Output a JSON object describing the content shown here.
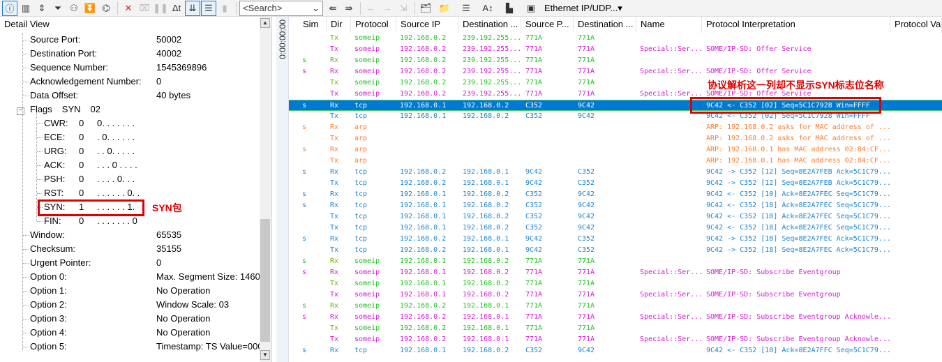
{
  "toolbar": {
    "search_placeholder": "<Search>",
    "channel": "Ethernet IP/UDP...",
    "icons": [
      "detail-view-icon",
      "statistics-icon",
      "split-icon",
      "filter-mail-icon",
      "filter-glasses-icon",
      "filter-sort-icon",
      "binoculars-icon",
      "delete-icon",
      "clear-icon",
      "pause-icon",
      "delta-time-icon",
      "scroll-down-icon",
      "filter-list-icon",
      "bar-filter-icon"
    ],
    "icons2": [
      "find-prev-icon",
      "find-next-icon",
      "back-icon",
      "forward-icon",
      "insert-icon",
      "mail-folder-icon",
      "globe-folder-icon",
      "columns-icon",
      "font-size-icon",
      "layout-icon",
      "network-icon"
    ]
  },
  "detail": {
    "title": "Detail View",
    "time": "0:00:00:00",
    "fields": [
      {
        "label": "Source Port:",
        "value": "50002"
      },
      {
        "label": "Destination Port:",
        "value": "40002"
      },
      {
        "label": "Sequence Number:",
        "value": "1545369896"
      },
      {
        "label": "Acknowledgement Number:",
        "value": "0"
      },
      {
        "label": "Data Offset:",
        "value": "40 bytes"
      }
    ],
    "flags": {
      "label": "Flags",
      "name": "SYN",
      "value": "02",
      "items": [
        {
          "label": "CWR:",
          "value": "0",
          "bits": "0. . .  . . . ."
        },
        {
          "label": "ECE:",
          "value": "0",
          "bits": ". 0. .  . . . ."
        },
        {
          "label": "URG:",
          "value": "0",
          "bits": ". . 0.  . . . ."
        },
        {
          "label": "ACK:",
          "value": "0",
          "bits": ". . . 0 . . . ."
        },
        {
          "label": "PSH:",
          "value": "0",
          "bits": ". . . .  0. . ."
        },
        {
          "label": "RST:",
          "value": "0",
          "bits": ". . . . . . 0. ."
        },
        {
          "label": "SYN:",
          "value": "1",
          "bits": ". . . . . . 1."
        },
        {
          "label": "FIN:",
          "value": "0",
          "bits": ". . . . . . . 0"
        }
      ]
    },
    "fields2": [
      {
        "label": "Window:",
        "value": "65535"
      },
      {
        "label": "Checksum:",
        "value": "35155"
      },
      {
        "label": "Urgent Pointer:",
        "value": "0"
      },
      {
        "label": "Option 0:",
        "value": "Max. Segment Size: 1460"
      },
      {
        "label": "Option 1:",
        "value": "No Operation"
      },
      {
        "label": "Option 2:",
        "value": "Window Scale: 03"
      },
      {
        "label": "Option 3:",
        "value": "No Operation"
      },
      {
        "label": "Option 4:",
        "value": "No Operation"
      },
      {
        "label": "Option 5:",
        "value": "Timestamp: TS Value=000"
      }
    ]
  },
  "annotations": {
    "syn": "SYN包",
    "interp": "协议解析这一列却不显示SYN标志位名称"
  },
  "columns": [
    "Sim",
    "Dir",
    "Protocol",
    "Source IP",
    "Destination ...",
    "Source P...",
    "Destination ...",
    "Name",
    "Protocol Interpretation",
    "Protocol Va"
  ],
  "colors": {
    "someip_green": "#1cc31c",
    "someip_magenta": "#d01ad0",
    "tcp": "#1a84d0",
    "arp": "#ff7a2a",
    "selected": "#0078d7",
    "annotation": "#e00000"
  },
  "selected_row": 6,
  "rows": [
    [
      "g",
      "",
      "Tx",
      "someip",
      "192.168.0.2",
      "239.192.255...",
      "771A",
      "771A",
      "",
      ""
    ],
    [
      "m",
      "",
      "Tx",
      "someip",
      "192.168.0.2",
      "239.192.255...",
      "771A",
      "771A",
      "Special::Ser...",
      "SOME/IP-SD: Offer Service"
    ],
    [
      "g",
      "s",
      "Rx",
      "someip",
      "192.168.0.2",
      "239.192.255...",
      "771A",
      "771A",
      "",
      ""
    ],
    [
      "m",
      "s",
      "Rx",
      "someip",
      "192.168.0.2",
      "239.192.255...",
      "771A",
      "771A",
      "Special::Ser...",
      "SOME/IP-SD: Offer Service"
    ],
    [
      "g",
      "",
      "Tx",
      "someip",
      "192.168.0.2",
      "239.192.255...",
      "771A",
      "771A",
      "",
      ""
    ],
    [
      "m",
      "",
      "Tx",
      "someip",
      "192.168.0.2",
      "239.192.255...",
      "771A",
      "771A",
      "Special::Ser...",
      "SOME/IP-SD: Offer Service"
    ],
    [
      "b",
      "s",
      "Rx",
      "tcp",
      "192.168.0.1",
      "192.168.0.2",
      "C352",
      "9C42",
      "",
      "9C42 <- C352 [02] Seq=5C1C7928 Win=FFFF"
    ],
    [
      "b",
      "",
      "Tx",
      "tcp",
      "192.168.0.1",
      "192.168.0.2",
      "C352",
      "9C42",
      "",
      "9C42 <- C352 [02] Seq=5C1C7928 Win=FFFF"
    ],
    [
      "o",
      "s",
      "Rx",
      "arp",
      "",
      "",
      "",
      "",
      "",
      "ARP: 192.168.0.2 asks for MAC address of ..."
    ],
    [
      "o",
      "",
      "Tx",
      "arp",
      "",
      "",
      "",
      "",
      "",
      "ARP: 192.168.0.2 asks for MAC address of ..."
    ],
    [
      "o",
      "s",
      "Rx",
      "arp",
      "",
      "",
      "",
      "",
      "",
      "ARP: 192.168.0.1 has MAC address 02:84:CF..."
    ],
    [
      "o",
      "",
      "Tx",
      "arp",
      "",
      "",
      "",
      "",
      "",
      "ARP: 192.168.0.1 has MAC address 02:84:CF..."
    ],
    [
      "b",
      "s",
      "Rx",
      "tcp",
      "192.168.0.2",
      "192.168.0.1",
      "9C42",
      "C352",
      "",
      "9C42 -> C352 [12] Seq=8E2A7FEB Ack=5C1C79..."
    ],
    [
      "b",
      "",
      "Tx",
      "tcp",
      "192.168.0.2",
      "192.168.0.1",
      "9C42",
      "C352",
      "",
      "9C42 -> C352 [12] Seq=8E2A7FEB Ack=5C1C79..."
    ],
    [
      "b",
      "s",
      "Rx",
      "tcp",
      "192.168.0.1",
      "192.168.0.2",
      "C352",
      "9C42",
      "",
      "9C42 <- C352 [10] Ack=8E2A7FEC Seq=5C1C79..."
    ],
    [
      "b",
      "s",
      "Rx",
      "tcp",
      "192.168.0.1",
      "192.168.0.2",
      "C352",
      "9C42",
      "",
      "9C42 <- C352 [18] Ack=8E2A7FEC Seq=5C1C79..."
    ],
    [
      "b",
      "",
      "Tx",
      "tcp",
      "192.168.0.1",
      "192.168.0.2",
      "C352",
      "9C42",
      "",
      "9C42 <- C352 [10] Ack=8E2A7FEC Seq=5C1C79..."
    ],
    [
      "b",
      "",
      "Tx",
      "tcp",
      "192.168.0.1",
      "192.168.0.2",
      "C352",
      "9C42",
      "",
      "9C42 <- C352 [18] Ack=8E2A7FEC Seq=5C1C79..."
    ],
    [
      "b",
      "s",
      "Rx",
      "tcp",
      "192.168.0.2",
      "192.168.0.1",
      "9C42",
      "C352",
      "",
      "9C42 -> C352 [18] Seq=8E2A7FEC Ack=5C1C79..."
    ],
    [
      "b",
      "",
      "Tx",
      "tcp",
      "192.168.0.2",
      "192.168.0.1",
      "9C42",
      "C352",
      "",
      "9C42 -> C352 [18] Seq=8E2A7FEC Ack=5C1C79..."
    ],
    [
      "g",
      "s",
      "Rx",
      "someip",
      "192.168.0.1",
      "192.168.0.2",
      "771A",
      "771A",
      "",
      ""
    ],
    [
      "m",
      "s",
      "Rx",
      "someip",
      "192.168.0.1",
      "192.168.0.2",
      "771A",
      "771A",
      "Special::Ser...",
      "SOME/IP-SD: Subscribe Eventgroup"
    ],
    [
      "g",
      "",
      "Tx",
      "someip",
      "192.168.0.1",
      "192.168.0.2",
      "771A",
      "771A",
      "",
      ""
    ],
    [
      "m",
      "",
      "Tx",
      "someip",
      "192.168.0.1",
      "192.168.0.2",
      "771A",
      "771A",
      "Special::Ser...",
      "SOME/IP-SD: Subscribe Eventgroup"
    ],
    [
      "g",
      "s",
      "Rx",
      "someip",
      "192.168.0.2",
      "192.168.0.1",
      "771A",
      "771A",
      "",
      ""
    ],
    [
      "m",
      "s",
      "Rx",
      "someip",
      "192.168.0.2",
      "192.168.0.1",
      "771A",
      "771A",
      "Special::Ser...",
      "SOME/IP-SD: Subscribe Eventgroup Acknowle..."
    ],
    [
      "g",
      "",
      "Tx",
      "someip",
      "192.168.0.2",
      "192.168.0.1",
      "771A",
      "771A",
      "",
      ""
    ],
    [
      "m",
      "",
      "Tx",
      "someip",
      "192.168.0.2",
      "192.168.0.1",
      "771A",
      "771A",
      "Special::Ser...",
      "SOME/IP-SD: Subscribe Eventgroup Acknowle..."
    ],
    [
      "b",
      "s",
      "Rx",
      "tcp",
      "192.168.0.1",
      "192.168.0.2",
      "C352",
      "9C42",
      "",
      "9C42 <- C352 [10] Ack=8E2A7FFC Seq=5C1C79..."
    ]
  ]
}
